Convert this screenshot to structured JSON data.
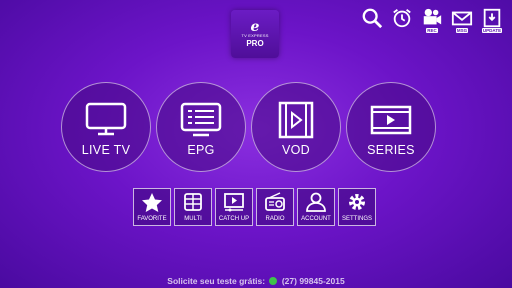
{
  "logo": {
    "letter": "e",
    "subtitle": "TV EXPRESS",
    "pro": "PRO"
  },
  "top_icons": [
    {
      "name": "search-icon",
      "caption": ""
    },
    {
      "name": "alarm-clock-icon",
      "caption": ""
    },
    {
      "name": "rec-icon",
      "caption": "REC"
    },
    {
      "name": "message-icon",
      "caption": "MSG"
    },
    {
      "name": "update-icon",
      "caption": "UPDATE"
    }
  ],
  "main_menu": [
    {
      "label": "LIVE TV",
      "icon": "tv-icon"
    },
    {
      "label": "EPG",
      "icon": "epg-icon"
    },
    {
      "label": "VOD",
      "icon": "film-icon"
    },
    {
      "label": "SERIES",
      "icon": "series-icon"
    }
  ],
  "sub_menu": [
    {
      "label": "FAVORITE",
      "icon": "star-icon"
    },
    {
      "label": "MULTI",
      "icon": "multi-screen-icon"
    },
    {
      "label": "CATCH UP",
      "icon": "catch-up-icon"
    },
    {
      "label": "RADIO",
      "icon": "radio-icon"
    },
    {
      "label": "ACCOUNT",
      "icon": "account-icon"
    },
    {
      "label": "SETTINGS",
      "icon": "gear-icon"
    }
  ],
  "footer": {
    "text": "Solicite seu teste grátis:",
    "phone": "(27) 99845-2015"
  },
  "colors": {
    "background": "#6c14c8",
    "accent": "#ffffff",
    "whatsapp": "#3ec24b"
  }
}
